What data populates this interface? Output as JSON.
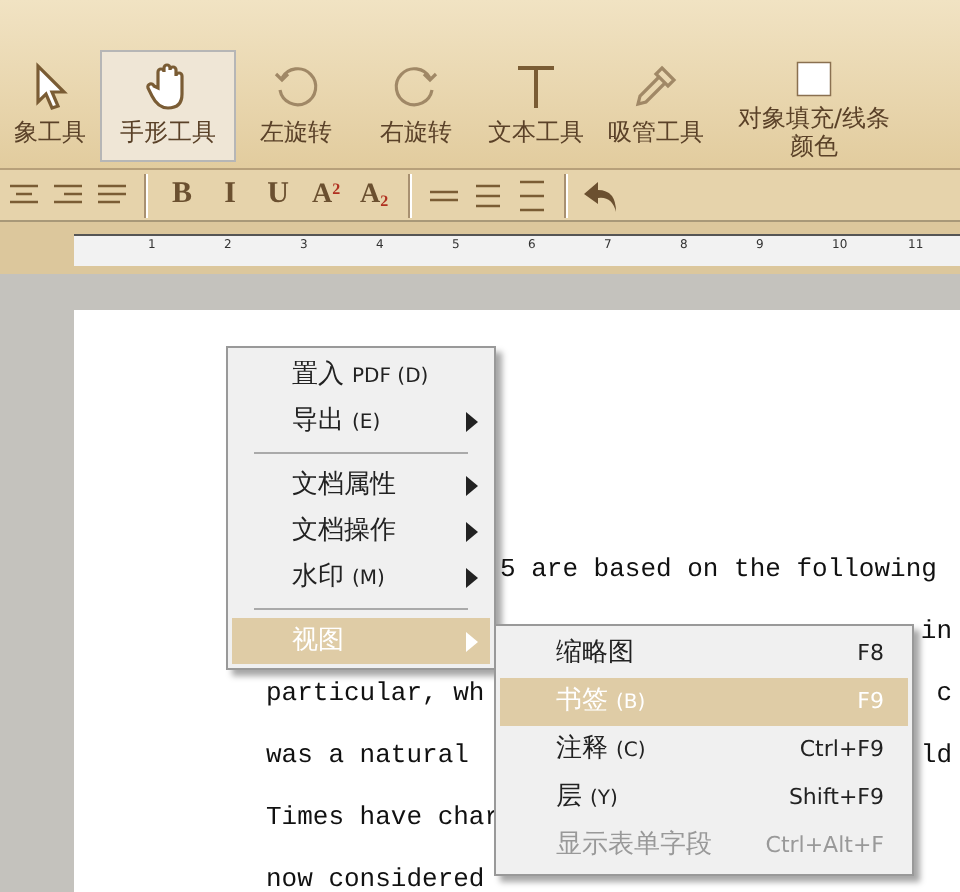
{
  "tools": [
    {
      "label": "象工具",
      "kind": "pointer",
      "selected": false
    },
    {
      "label": "手形工具",
      "kind": "hand",
      "selected": true
    },
    {
      "label": "左旋转",
      "kind": "rotate-left",
      "selected": false
    },
    {
      "label": "右旋转",
      "kind": "rotate-right",
      "selected": false
    },
    {
      "label": "文本工具",
      "kind": "text",
      "selected": false
    },
    {
      "label": "吸管工具",
      "kind": "eyedropper",
      "selected": false
    },
    {
      "label": "对象填充/线条颜色",
      "kind": "fill",
      "selected": false
    }
  ],
  "format_bar": [
    {
      "kind": "align-center"
    },
    {
      "kind": "align-right"
    },
    {
      "kind": "justify"
    },
    {
      "kind": "sep"
    },
    {
      "kind": "char",
      "text": "B"
    },
    {
      "kind": "char",
      "text": "I"
    },
    {
      "kind": "char",
      "text": "U"
    },
    {
      "kind": "sup",
      "text": "A",
      "mark": "2"
    },
    {
      "kind": "sub",
      "text": "A",
      "mark": "2"
    },
    {
      "kind": "sep"
    },
    {
      "kind": "spacing-1"
    },
    {
      "kind": "spacing-2"
    },
    {
      "kind": "spacing-3"
    },
    {
      "kind": "sep"
    },
    {
      "kind": "undo"
    }
  ],
  "ruler": [
    "1",
    "2",
    "3",
    "4",
    "5",
    "6",
    "7",
    "8",
    "9",
    "10",
    "11"
  ],
  "document_lines": [
    {
      "kind": "after_menu",
      "text": "5 are based on the following"
    },
    {
      "kind": "right_only",
      "right": "in"
    },
    {
      "kind": "split",
      "left": "particular, wh",
      "right": "c"
    },
    {
      "kind": "split",
      "left": "was a natural",
      "right": "ld"
    },
    {
      "kind": "split",
      "left": "Times have char"
    },
    {
      "kind": "split",
      "left": "now considered"
    }
  ],
  "context_menu": [
    {
      "kind": "item",
      "label": "置入",
      "accel": "PDF (D)",
      "submenu": false,
      "selected": false
    },
    {
      "kind": "item",
      "label": "导出",
      "accel": "(E)",
      "submenu": true,
      "selected": false
    },
    {
      "kind": "separator"
    },
    {
      "kind": "item",
      "label": "文档属性",
      "submenu": true,
      "selected": false
    },
    {
      "kind": "item",
      "label": "文档操作",
      "submenu": true,
      "selected": false
    },
    {
      "kind": "item",
      "label": "水印",
      "accel": "(M)",
      "submenu": true,
      "selected": false
    },
    {
      "kind": "separator"
    },
    {
      "kind": "item",
      "label": "视图",
      "submenu": true,
      "selected": true
    }
  ],
  "submenu": [
    {
      "label": "缩略图",
      "shortcut": "F8",
      "selected": false,
      "disabled": false
    },
    {
      "label": "书签",
      "accel": "(B)",
      "shortcut": "F9",
      "selected": true,
      "disabled": false
    },
    {
      "label": "注释",
      "accel": "(C)",
      "shortcut": "Ctrl+F9",
      "selected": false,
      "disabled": false
    },
    {
      "label": "层",
      "accel": "(Y)",
      "shortcut": "Shift+F9",
      "selected": false,
      "disabled": false
    },
    {
      "label": "显示表单字段",
      "shortcut": "Ctrl+Alt+F",
      "selected": false,
      "disabled": true
    }
  ]
}
